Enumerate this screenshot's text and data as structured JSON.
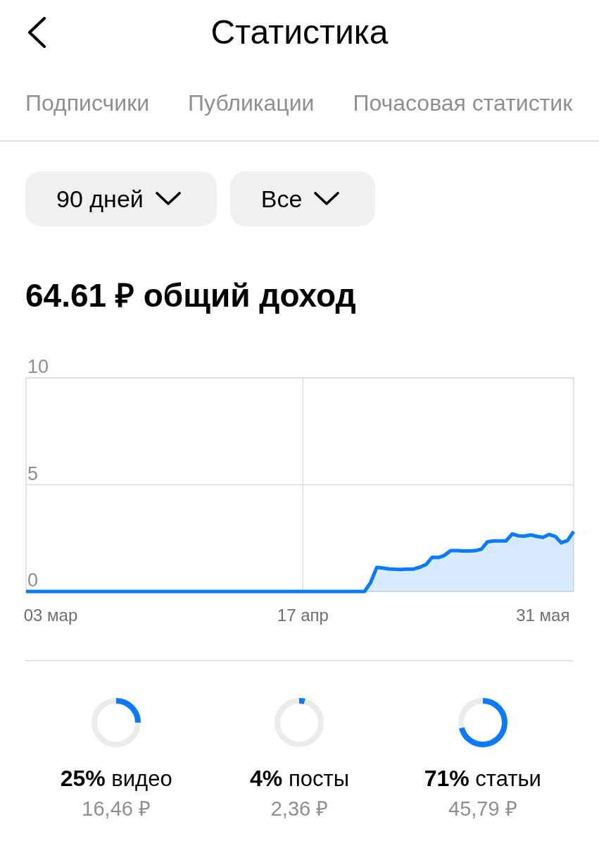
{
  "header": {
    "title": "Статистика"
  },
  "tabs": [
    {
      "label": "Подписчики",
      "selected": false
    },
    {
      "label": "Публикации",
      "selected": false
    },
    {
      "label": "Почасовая статистик",
      "selected": false
    }
  ],
  "filters": [
    {
      "label": "90 дней"
    },
    {
      "label": "Все"
    }
  ],
  "income": {
    "total": "64.61 ₽ общий доход",
    "chart_data": {
      "type": "area",
      "categories": [
        null,
        null,
        null,
        null,
        "03 мар",
        null,
        null,
        null,
        null,
        null,
        null,
        null,
        null,
        null,
        null,
        null,
        null,
        null,
        null,
        null,
        null,
        null,
        null,
        null,
        null,
        null,
        null,
        null,
        null,
        null,
        null,
        null,
        null,
        null,
        null,
        null,
        null,
        null,
        null,
        null,
        null,
        null,
        null,
        null,
        null,
        "17 апр",
        null,
        null,
        null,
        null,
        null,
        null,
        null,
        null,
        null,
        null,
        null,
        null,
        null,
        null,
        null,
        null,
        null,
        null,
        null,
        null,
        null,
        null,
        null,
        null,
        null,
        null,
        null,
        null,
        null,
        null,
        null,
        null,
        null,
        null,
        null,
        null,
        null,
        null,
        "31 мая",
        null,
        null,
        null,
        null,
        null
      ],
      "series": [
        {
          "color": "#0a7aff",
          "values": [
            0,
            0,
            0,
            0,
            0,
            0,
            0,
            0,
            0,
            0,
            0,
            0,
            0,
            0,
            0,
            0,
            0,
            0,
            0,
            0,
            0,
            0,
            0,
            0,
            0,
            0,
            0,
            0,
            0,
            0,
            0,
            0,
            0,
            0,
            0,
            0,
            0,
            0,
            0,
            0,
            0,
            0,
            0,
            0,
            0,
            0,
            0,
            0,
            0,
            0,
            0,
            0,
            0,
            0,
            0,
            0,
            0.42,
            1.13,
            1.1,
            1.06,
            1.04,
            1.03,
            1.05,
            1.05,
            1.14,
            1.26,
            1.6,
            1.59,
            1.69,
            1.91,
            1.91,
            1.9,
            1.9,
            1.91,
            1.98,
            2.33,
            2.37,
            2.37,
            2.37,
            2.69,
            2.61,
            2.59,
            2.65,
            2.58,
            2.53,
            2.67,
            2.58,
            2.28,
            2.39,
            2.81
          ]
        }
      ],
      "ylim": [
        0,
        10
      ],
      "yticks": [
        0,
        5,
        10
      ]
    }
  },
  "shares": [
    {
      "label": "**25%** видео",
      "amount": "16,46 ₽",
      "level": 0.25
    },
    {
      "label": "**4%** посты",
      "amount": "2,36 ₽",
      "level": 0.04
    },
    {
      "label": "**71%** статьи",
      "amount": "45,79 ₽",
      "level": 0.71
    }
  ]
}
